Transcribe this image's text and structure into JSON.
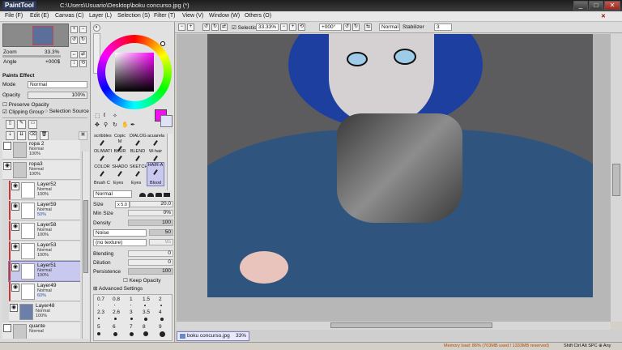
{
  "app": {
    "logo": "PaintTool SAI",
    "title": "C:\\Users\\Usuario\\Desktop\\boku concurso.jpg (*)"
  },
  "menu": [
    "File (F)",
    "Edit (E)",
    "Canvas (C)",
    "Layer (L)",
    "Selection (S)",
    "Filter (T)",
    "View (V)",
    "Window (W)",
    "Others (O)"
  ],
  "navigator": {
    "zoom_label": "Zoom",
    "zoom_value": "33.3%",
    "angle_label": "Angle",
    "angle_value": "+000$"
  },
  "layer_props": {
    "paints_effect": "Paints Effect",
    "mode_label": "Mode",
    "mode_value": "Normal",
    "opacity_label": "Opacity",
    "opacity_value": "100%",
    "preserve_opacity": "Preserve Opacity",
    "clipping_group": "Clipping Group",
    "selection_source": "Selection Source"
  },
  "layers": [
    {
      "name": "ropa 2",
      "mode": "Normal",
      "opacity": "100%",
      "folder": true
    },
    {
      "name": "ropa3",
      "mode": "Normal",
      "opacity": "100%",
      "folder": true
    },
    {
      "name": "Layer52",
      "mode": "Normal",
      "opacity": "100%"
    },
    {
      "name": "Layer59",
      "mode": "Normal",
      "opacity": "50%"
    },
    {
      "name": "Layer58",
      "mode": "Normal",
      "opacity": "100%"
    },
    {
      "name": "Layer53",
      "mode": "Normal",
      "opacity": "100%"
    },
    {
      "name": "Layer51",
      "mode": "Normal",
      "opacity": "100%",
      "selected": true
    },
    {
      "name": "Layer49",
      "mode": "Normal",
      "opacity": "60%"
    },
    {
      "name": "Layer48",
      "mode": "Normal",
      "opacity": "100%"
    },
    {
      "name": "quante",
      "mode": "Normal",
      "opacity": "",
      "folder": true
    }
  ],
  "colors": {
    "primary": "#ee11ee",
    "secondary": "#dde3f5",
    "accent": "#7a7ab5"
  },
  "brushes": {
    "row1": [
      "scribbles",
      "Copic M",
      "DIALOG",
      "acuarela"
    ],
    "row2": [
      "OLIWATI",
      "BLUR",
      "BLEND",
      "W-hair"
    ],
    "row3": [
      "COLOR",
      "SHADO",
      "SKETCH",
      "HAIR-A"
    ],
    "row4": [
      "Brush C",
      "Eyes",
      "Eyes",
      "Blood"
    ]
  },
  "brush_settings": {
    "mode": "Normal",
    "size_label": "Size",
    "size_mult": "x 5.0",
    "size_value": "20.0",
    "minsize_label": "Min Size",
    "minsize_value": "0%",
    "density_label": "Density",
    "density_value": "100",
    "noise_label": "Noise",
    "noise_value": "50",
    "texture_label": "(no texture)",
    "texture_value": "95",
    "blending_label": "Blending",
    "blending_value": "0",
    "dilution_label": "Dilution",
    "dilution_value": "0",
    "persistence_label": "Persistence",
    "persistence_value": "100",
    "keep_opacity": "Keep Opacity",
    "advanced": "Advanced Settings",
    "size_presets": [
      "0.7",
      "0.8",
      "1",
      "1.5",
      "2",
      "2.3",
      "2.6",
      "3",
      "3.5",
      "4",
      "5",
      "6",
      "7",
      "8",
      "9"
    ]
  },
  "canvas_toolbar": {
    "selection": "Selection",
    "zoom": "33.33%",
    "angle": "+000°",
    "mode": "Normal",
    "stabilizer_label": "Stabilizer",
    "stabilizer": "3"
  },
  "tab": {
    "name": "boku concurso.jpg",
    "zoom": "33%"
  },
  "status": {
    "memory": "Memory load: 86% (703MB used / 1333MB reserved)",
    "keys": "Shift Ctrl Alt SPC ⊕ Any"
  }
}
